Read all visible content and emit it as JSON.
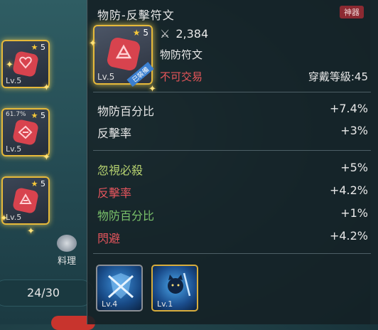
{
  "left_panel": {
    "slots": [
      {
        "level": "Lv.5",
        "stars": "5",
        "percent": ""
      },
      {
        "level": "Lv.5",
        "stars": "5",
        "percent": "61.7%"
      },
      {
        "level": "Lv.5",
        "stars": "5",
        "percent": ""
      }
    ],
    "cooking_label": "料理",
    "count": "24/30"
  },
  "tooltip": {
    "title": "物防-反擊符文",
    "badge": "神器",
    "item": {
      "level": "Lv.5",
      "stars": "5",
      "equipped_tag": "已裝備"
    },
    "power": "2,384",
    "subtype": "物防符文",
    "trade_status": "不可交易",
    "equip_level": "穿戴等級:45",
    "main_stats": [
      {
        "label": "物防百分比",
        "value": "+7.4%"
      },
      {
        "label": "反擊率",
        "value": "+3%"
      }
    ],
    "sub_stats": [
      {
        "label": "忽視必殺",
        "value": "+5%",
        "color": "#b8d470"
      },
      {
        "label": "反擊率",
        "value": "+4.2%",
        "color": "#e6555d"
      },
      {
        "label": "物防百分比",
        "value": "+1%",
        "color": "#7bc26b"
      },
      {
        "label": "閃避",
        "value": "+4.2%",
        "color": "#e6555d"
      }
    ],
    "skills": [
      {
        "level": "Lv.4",
        "icon": "shield-cross-icon"
      },
      {
        "level": "Lv.1",
        "icon": "cat-warrior-icon"
      }
    ]
  },
  "colors": {
    "gold_border": "#e6b93a",
    "rune_red": "#d8434e",
    "negative": "#e6555d",
    "positive": "#7bc26b"
  }
}
